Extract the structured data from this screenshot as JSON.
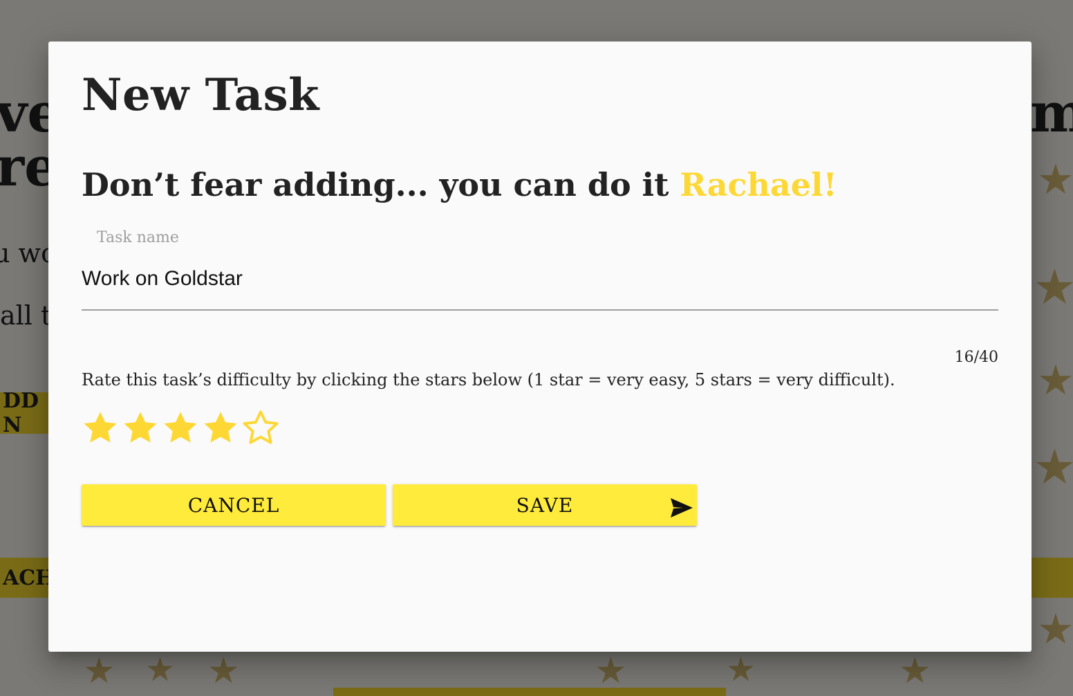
{
  "background": {
    "fragments": [
      "ve",
      "re",
      "u wo",
      "all t",
      "me"
    ],
    "bars": [
      "DD N",
      "ACH"
    ]
  },
  "modal": {
    "title": "New Task",
    "subtitle_prefix": "Don’t fear adding... you can do it ",
    "user_name": "Rachael!",
    "field": {
      "label": "Task name",
      "value": "Work on Goldstar",
      "counter": "16/40"
    },
    "instructions": "Rate this task’s difficulty by clicking the stars below (1 star = very easy, 5 stars = very difficult).",
    "rating": {
      "value": 4,
      "max": 5
    },
    "buttons": {
      "cancel": "CANCEL",
      "save": "SAVE"
    }
  },
  "colors": {
    "accent": "#ffeb3b",
    "name_highlight": "#fdd835",
    "star_fill": "#fdd835",
    "backdrop": "rgba(0,0,0,0.5)"
  },
  "icons": {
    "star_filled": "star-filled-icon",
    "star_empty": "star-outline-icon",
    "send": "send-icon"
  }
}
